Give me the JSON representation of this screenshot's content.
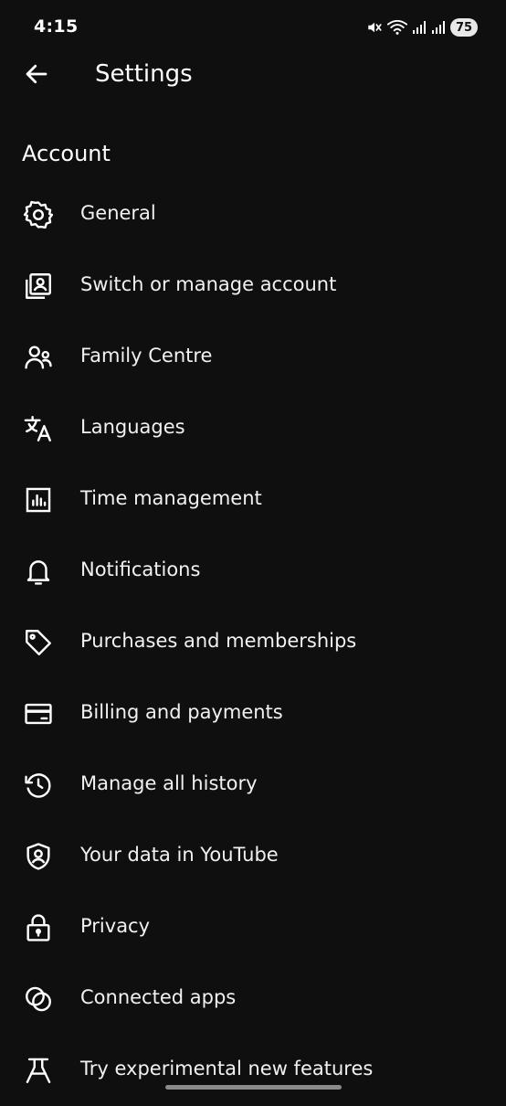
{
  "status_bar": {
    "time": "4:15",
    "battery": "75",
    "icons": [
      "mute-icon",
      "wifi-icon",
      "signal-icon",
      "signal-icon"
    ]
  },
  "header": {
    "back_icon": "arrow-left-icon",
    "title": "Settings"
  },
  "section": {
    "title": "Account"
  },
  "items": [
    {
      "label": "General",
      "icon": "gear-icon"
    },
    {
      "label": "Switch or manage account",
      "icon": "account-box-icon"
    },
    {
      "label": "Family Centre",
      "icon": "family-icon"
    },
    {
      "label": "Languages",
      "icon": "translate-icon"
    },
    {
      "label": "Time management",
      "icon": "chart-icon"
    },
    {
      "label": "Notifications",
      "icon": "bell-icon"
    },
    {
      "label": "Purchases and memberships",
      "icon": "tag-icon"
    },
    {
      "label": "Billing and payments",
      "icon": "card-icon"
    },
    {
      "label": "Manage all history",
      "icon": "history-icon"
    },
    {
      "label": "Your data in YouTube",
      "icon": "shield-person-icon"
    },
    {
      "label": "Privacy",
      "icon": "lock-icon"
    },
    {
      "label": "Connected apps",
      "icon": "connected-apps-icon"
    },
    {
      "label": "Try experimental new features",
      "icon": "flask-icon"
    }
  ],
  "colors": {
    "background": "#0f0f0f",
    "text": "#f1f1f1",
    "icon": "#ffffff",
    "battery_pill": "#e8e8e8"
  }
}
